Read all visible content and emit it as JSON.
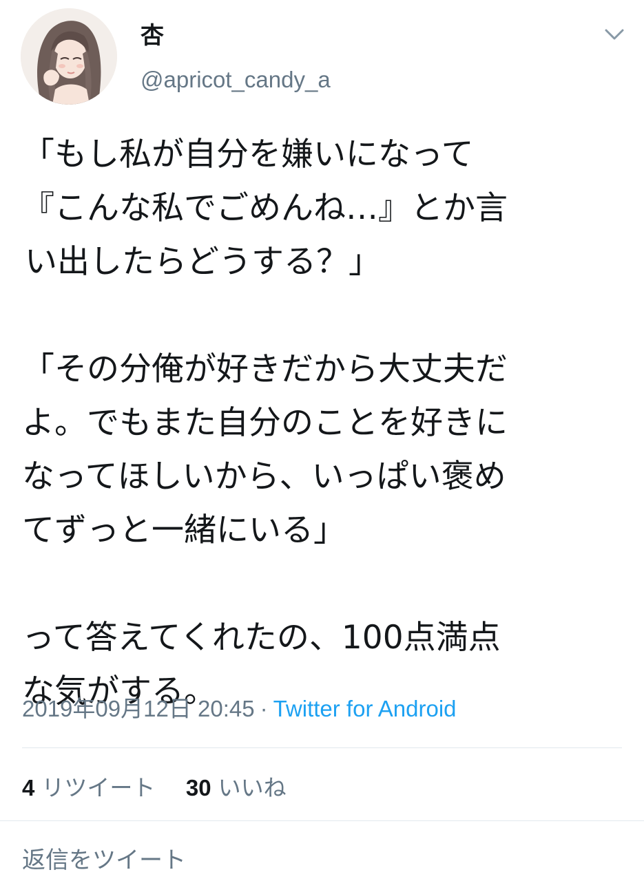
{
  "author": {
    "display_name": "杏",
    "handle": "@apricot_candy_a",
    "avatar_icon": "portrait-illustration"
  },
  "menu_icon": "chevron-down-icon",
  "tweet": {
    "lines": [
      "「もし私が自分を嫌いになって",
      "『こんな私でごめんね…』とか言",
      "い出したらどうする？」",
      "",
      "「その分俺が好きだから大丈夫だ",
      "よ。でもまた自分のことを好きに",
      "なってほしいから、いっぱい褒め",
      "てずっと一緒にいる」",
      "",
      "って答えてくれたの、100点満点",
      "な気がする。"
    ]
  },
  "meta": {
    "timestamp": "2019年09月12日 20:45",
    "separator": "·",
    "source": "Twitter for Android"
  },
  "stats": {
    "retweet_count": "4",
    "retweet_label": "リツイート",
    "like_count": "30",
    "like_label": "いいね"
  },
  "reply": {
    "placeholder": "返信をツイート"
  },
  "colors": {
    "text": "#14171a",
    "secondary": "#657786",
    "link": "#1da1f2",
    "divider": "#e1e8ed"
  }
}
